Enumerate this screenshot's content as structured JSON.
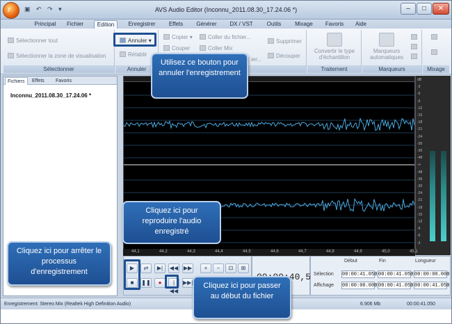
{
  "window": {
    "title": "AVS Audio Editor  (Inconnu_2011.08.30_17.24.06 *)",
    "minimize": "–",
    "maximize": "□",
    "close": "✕"
  },
  "menu_tabs": [
    "Principal",
    "Fichier",
    "Edition",
    "Enregistrer",
    "Effets",
    "Générer",
    "DX / VST",
    "Outils",
    "Mixage",
    "Favoris",
    "Aide"
  ],
  "ribbon": {
    "select_all": "Sélectionner tout",
    "select_view": "Sélectionner la zone de visualisation",
    "group_select": "Sélectionner",
    "undo": "Annuler",
    "redo": "Rétablir",
    "group_undo": "Annuler",
    "copy": "Copier",
    "cut": "Couper",
    "paste_file": "Coller du fichier...",
    "paste_mix": "Coller Mix",
    "paste_new": "ier...",
    "delete": "Supprimer",
    "split": "Découper",
    "group_edit": "Edition",
    "convert": "Convertir le type d'échantillon",
    "group_treatment": "Traitement",
    "markers_auto": "Marqueurs automatiques",
    "group_markers": "Marqueurs",
    "group_mix": "Mixage"
  },
  "left_panel": {
    "tabs": [
      "Fichiers",
      "Effets",
      "Favoris"
    ],
    "file": "Inconnu_2011.08.30_17.24.06 *"
  },
  "scale_labels": [
    "dB",
    "-3",
    "-6",
    "-9",
    "-12",
    "-15",
    "-18",
    "-21",
    "-24",
    "-30",
    "-36",
    "-48",
    "-∞",
    "-48",
    "-36",
    "-30",
    "-24",
    "-21",
    "-18",
    "-15",
    "-12",
    "-9",
    "-6",
    "-3"
  ],
  "timeline": [
    "44,1",
    "44,2",
    "44,3",
    "44,4",
    "44,5",
    "44,6",
    "44,7",
    "44,8",
    "44,9",
    "45,0",
    "45,1"
  ],
  "time_display": "00:00:40,550",
  "selection": {
    "col_start": "Début",
    "col_end": "Fin",
    "col_length": "Longueur",
    "row_selection": "Sélection",
    "row_display": "Affichage",
    "sel_start": "00:00:41.050",
    "sel_end": "00:00:41.050",
    "sel_len": "00:00:00.000",
    "disp_start": "00:00:00.000",
    "disp_end": "00:00:41.050",
    "disp_len": "00:00:41.050"
  },
  "status": {
    "recording": "Enregistrement: Stereo Mix (Realtek High Definition Audio)",
    "size": "6.906 Mb",
    "duration": "00:00:41.050"
  },
  "callouts": {
    "undo": "Utilisez ce bouton pour annuler l'enregistrement",
    "play": "Cliquez ici pour reproduire l'audio enregistré",
    "stop": "Cliquez ici pour arrêter le processus d'enregistrement",
    "start": "Cliquez ici pour passer au début du fichier"
  },
  "colors": {
    "accent": "#1e4f92",
    "wave": "#4aa8e0",
    "meter": "#4bd0cc"
  }
}
